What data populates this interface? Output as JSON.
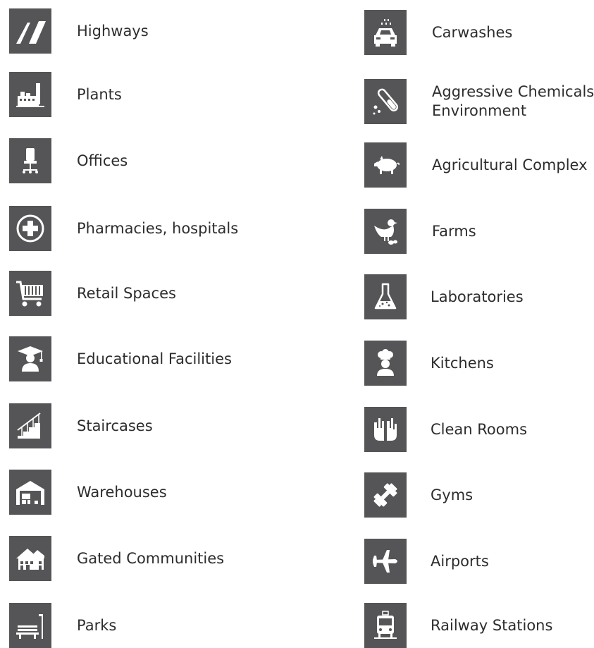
{
  "items": {
    "highways": {
      "label": "Highways",
      "icon": "highway-icon"
    },
    "plants": {
      "label": "Plants",
      "icon": "factory-icon"
    },
    "offices": {
      "label": "Offices",
      "icon": "office-chair-icon"
    },
    "pharmacies": {
      "label": "Pharmacies, hospitals",
      "icon": "medical-cross-icon"
    },
    "retail": {
      "label": "Retail Spaces",
      "icon": "shopping-cart-icon"
    },
    "education": {
      "label": "Educational Facilities",
      "icon": "graduate-icon"
    },
    "staircases": {
      "label": "Staircases",
      "icon": "staircase-icon"
    },
    "warehouses": {
      "label": "Warehouses",
      "icon": "warehouse-icon"
    },
    "gated": {
      "label": "Gated Communities",
      "icon": "house-icon"
    },
    "parks": {
      "label": "Parks",
      "icon": "park-bench-icon"
    },
    "carwashes": {
      "label": "Carwashes",
      "icon": "carwash-icon"
    },
    "chemicals": {
      "label_line1": "Aggressive Chemicals",
      "label_line2": "Environment",
      "icon": "test-tube-icon"
    },
    "agricultural": {
      "label": "Agricultural Complex",
      "icon": "pig-icon"
    },
    "farms": {
      "label": "Farms",
      "icon": "chicken-icon"
    },
    "laboratories": {
      "label": "Laboratories",
      "icon": "flask-icon"
    },
    "kitchens": {
      "label": "Kitchens",
      "icon": "chef-icon"
    },
    "cleanrooms": {
      "label": "Clean Rooms",
      "icon": "gloves-icon"
    },
    "gyms": {
      "label": "Gyms",
      "icon": "dumbbell-icon"
    },
    "airports": {
      "label": "Airports",
      "icon": "airplane-icon"
    },
    "railway": {
      "label": "Railway Stations",
      "icon": "train-icon"
    }
  },
  "colors": {
    "tile": "#555557",
    "icon": "#ffffff",
    "text": "#2d2d2d"
  }
}
